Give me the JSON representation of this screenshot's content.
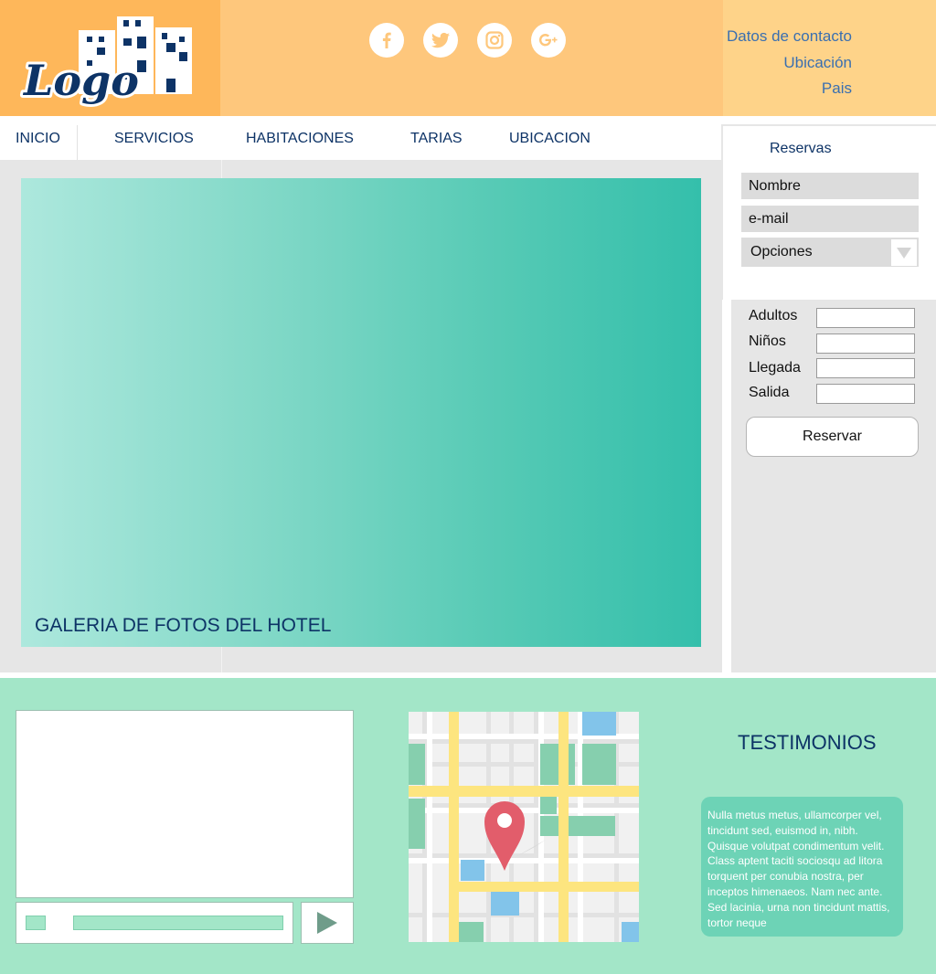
{
  "header": {
    "logo_text": "Logo",
    "social": [
      {
        "icon": "facebook-icon"
      },
      {
        "icon": "twitter-icon"
      },
      {
        "icon": "instagram-icon"
      },
      {
        "icon": "google-plus-icon"
      }
    ],
    "contact_links": [
      "Datos de contacto",
      "Ubicación",
      "Pais"
    ]
  },
  "nav": {
    "items": [
      "INICIO",
      "SERVICIOS",
      "HABITACIONES",
      "TARIAS",
      "UBICACION"
    ]
  },
  "gallery": {
    "caption": "GALERIA DE FOTOS DEL HOTEL"
  },
  "reservations": {
    "title": "Reservas",
    "fields": {
      "name": "Nombre",
      "email": "e-mail",
      "options": "Opciones"
    },
    "guest_fields": [
      "Adultos",
      "Niños",
      "Llegada",
      "Salida"
    ],
    "submit_label": "Reservar"
  },
  "testimonials": {
    "title": "TESTIMONIOS",
    "text": "Nulla metus metus, ullamcorper vel, tincidunt sed, euismod in, nibh. Quisque volutpat condimentum velit. Class aptent taciti sociosqu ad litora torquent per conubia nostra, per inceptos himenaeos. Nam nec ante. Sed lacinia, urna non tincidunt mattis, tortor neque"
  },
  "colors": {
    "header_orange": "#feb75a",
    "header_light": "#fec77c",
    "navy": "#0d3366",
    "mint": "#a3e6c8",
    "teal": "#34bfab",
    "panel_gray": "#e6e6e6"
  }
}
